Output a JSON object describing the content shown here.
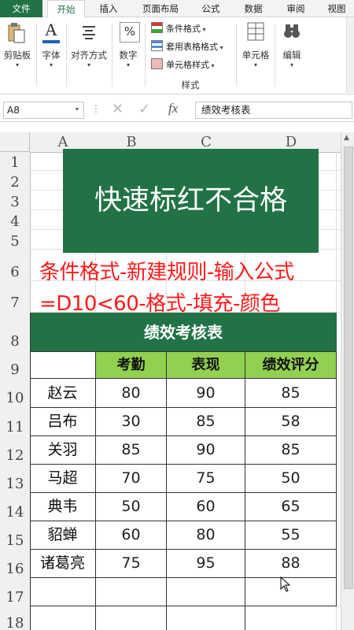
{
  "ribbon_tabs": [
    "文件",
    "开始",
    "插入",
    "页面布局",
    "公式",
    "数据",
    "审阅",
    "视图"
  ],
  "ribbon": {
    "clipboard": "剪贴板",
    "font": "字体",
    "align": "对齐方式",
    "number": "数字",
    "cond_format": "条件格式",
    "table_format": "套用表格格式",
    "cell_style": "单元格样式",
    "styles_group": "样式",
    "cells": "单元格",
    "edit": "编辑",
    "percent": "%",
    "font_letter": "A"
  },
  "formula_bar": {
    "name_box": "A8",
    "fx": "fx",
    "formula": "绩效考核表"
  },
  "columns": [
    "A",
    "B",
    "C",
    "D"
  ],
  "rows": [
    "1",
    "2",
    "3",
    "4",
    "5",
    "6",
    "7",
    "8",
    "9",
    "10",
    "11",
    "12",
    "13",
    "14",
    "15",
    "16",
    "17",
    "18"
  ],
  "banner": {
    "title": "快速标红不合格",
    "color": "#217346"
  },
  "instruction": {
    "line1": "条件格式-新建规则-输入公式",
    "line2": "=D10<60-格式-填充-颜色",
    "color": "#ff1a1a"
  },
  "table": {
    "title": "绩效考核表",
    "title_bg": "#217346",
    "header_bg": "#92d050",
    "headers": [
      "",
      "考勤",
      "表现",
      "绩效评分"
    ],
    "rows": [
      {
        "name": "赵云",
        "attendance": "80",
        "performance": "90",
        "score": "85"
      },
      {
        "name": "吕布",
        "attendance": "30",
        "performance": "85",
        "score": "58"
      },
      {
        "name": "关羽",
        "attendance": "85",
        "performance": "90",
        "score": "85"
      },
      {
        "name": "马超",
        "attendance": "70",
        "performance": "75",
        "score": "50"
      },
      {
        "name": "典韦",
        "attendance": "50",
        "performance": "60",
        "score": "65"
      },
      {
        "name": "貂蝉",
        "attendance": "60",
        "performance": "80",
        "score": "55"
      },
      {
        "name": "诸葛亮",
        "attendance": "75",
        "performance": "95",
        "score": "88"
      }
    ]
  }
}
